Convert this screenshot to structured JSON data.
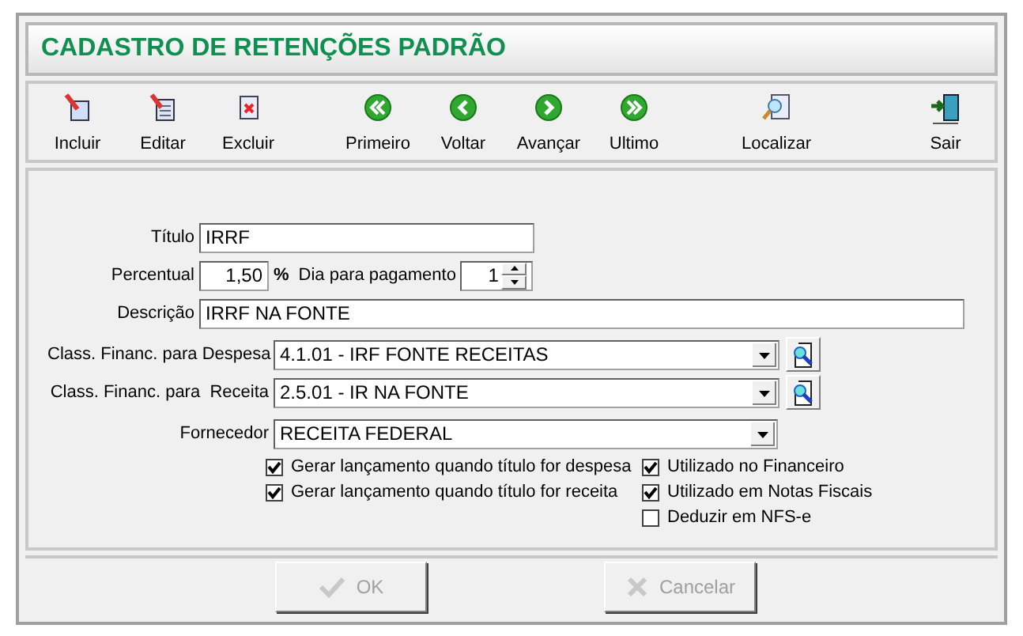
{
  "window": {
    "title": "CADASTRO DE RETENÇÕES PADRÃO"
  },
  "toolbar": {
    "groups": [
      [
        {
          "label": "Incluir",
          "kind": "new"
        },
        {
          "label": "Editar",
          "kind": "edit"
        },
        {
          "label": "Excluir",
          "kind": "delete"
        }
      ],
      [
        {
          "label": "Primeiro",
          "kind": "first"
        },
        {
          "label": "Voltar",
          "kind": "prev"
        },
        {
          "label": "Avançar",
          "kind": "next"
        },
        {
          "label": "Ultimo",
          "kind": "last"
        }
      ],
      [
        {
          "label": "Localizar",
          "kind": "find"
        }
      ]
    ],
    "exit": {
      "label": "Sair",
      "kind": "exit"
    }
  },
  "form": {
    "titulo": {
      "label": "Título",
      "value": "IRRF"
    },
    "percentual": {
      "label": "Percentual",
      "value": "1,50",
      "unit": "%"
    },
    "dia": {
      "label": "Dia para pagamento",
      "value": "1"
    },
    "descricao": {
      "label": "Descrição",
      "value": "IRRF NA FONTE"
    },
    "selects": [
      {
        "label": "Class. Financ. para Despesa",
        "value": "4.1.01 - IRF FONTE RECEITAS",
        "lookup": true
      },
      {
        "label": "Class. Financ. para  Receita",
        "value": "2.5.01 - IR NA FONTE",
        "lookup": true
      },
      {
        "label": "Fornecedor",
        "value": "RECEITA FEDERAL",
        "lookup": false
      }
    ],
    "checks_left": [
      {
        "label": "Gerar lançamento quando título for despesa",
        "checked": true
      },
      {
        "label": "Gerar lançamento quando título for receita",
        "checked": true
      }
    ],
    "checks_right": [
      {
        "label": "Utilizado no Financeiro",
        "checked": true
      },
      {
        "label": "Utilizado em Notas Fiscais",
        "checked": true
      },
      {
        "label": "Deduzir em NFS-e",
        "checked": false
      }
    ]
  },
  "buttons": [
    {
      "label": "OK",
      "kind": "ok",
      "disabled": true
    },
    {
      "label": "Cancelar",
      "kind": "cancel",
      "disabled": true
    }
  ]
}
